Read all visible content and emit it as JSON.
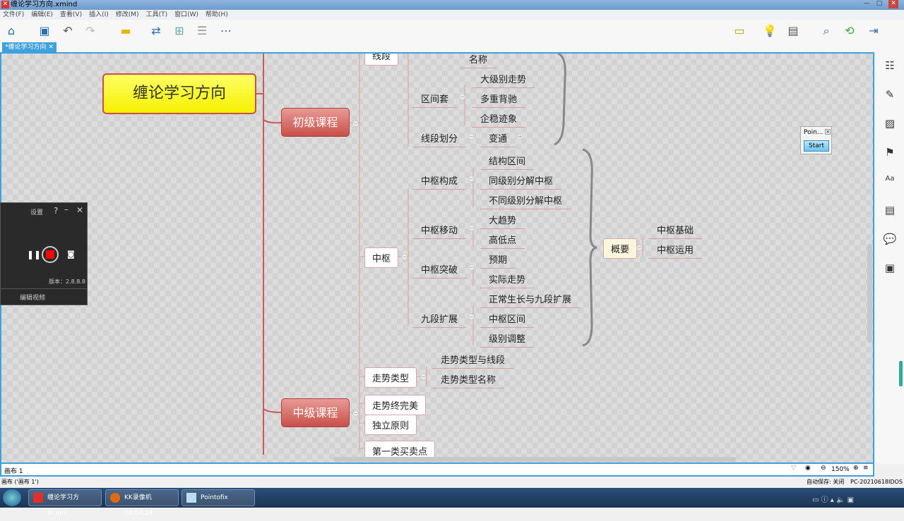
{
  "window": {
    "title": "缠论学习方向.xmind",
    "controls": [
      "—",
      "□",
      "✕"
    ]
  },
  "menu": [
    "文件(F)",
    "编辑(E)",
    "查看(V)",
    "插入(I)",
    "修改(M)",
    "工具(T)",
    "窗口(W)",
    "帮助(H)"
  ],
  "tab": {
    "label": "*缠论学习方向",
    "close": "✕"
  },
  "map": {
    "root": "缠论学习方向",
    "beginner": "初级课程",
    "intermediate": "中级课程",
    "xianduan": "线段",
    "mingcheng": "名称",
    "qujiantao": "区间套",
    "qujiantao_children": [
      "大级别走势",
      "多重背驰",
      "企稳迹象"
    ],
    "xianduanhuafen": "线段划分",
    "biantong": "变通",
    "zhongshu": "中枢",
    "groups": [
      {
        "label": "中枢构成",
        "children": [
          "结构区间",
          "同级别分解中枢",
          "不同级别分解中枢"
        ]
      },
      {
        "label": "中枢移动",
        "children": [
          "大趋势",
          "高低点"
        ]
      },
      {
        "label": "中枢突破",
        "children": [
          "预期",
          "实际走势"
        ]
      },
      {
        "label": "九段扩展",
        "children": [
          "正常生长与九段扩展",
          "中枢区间",
          "级别调整"
        ]
      }
    ],
    "summary": {
      "label": "概要",
      "children": [
        "中枢基础",
        "中枢运用"
      ]
    },
    "trend": {
      "label": "走势类型",
      "children": [
        "走势类型与线段",
        "走势类型名称"
      ]
    },
    "mid_children": [
      "走势终完美",
      "独立原则"
    ],
    "buy_sell": "第一类买卖点"
  },
  "recorder": {
    "settings": "设置",
    "help": "?",
    "version": "版本：2.8.8.8",
    "edit_video": "编辑视频"
  },
  "pointofix": {
    "title": "Poin...",
    "start": "Start"
  },
  "bottom": {
    "sheet": "画布 1",
    "zoom": "150%"
  },
  "status": {
    "left": "画布 ('画布 1')",
    "autosave": "自动保存: 关闭",
    "pc": "PC-20210618IDOS"
  },
  "taskbar": [
    {
      "label": "缠论学习方向.xmi..."
    },
    {
      "label": "KK录像机 00:03:24"
    },
    {
      "label": "Pointofix"
    }
  ]
}
